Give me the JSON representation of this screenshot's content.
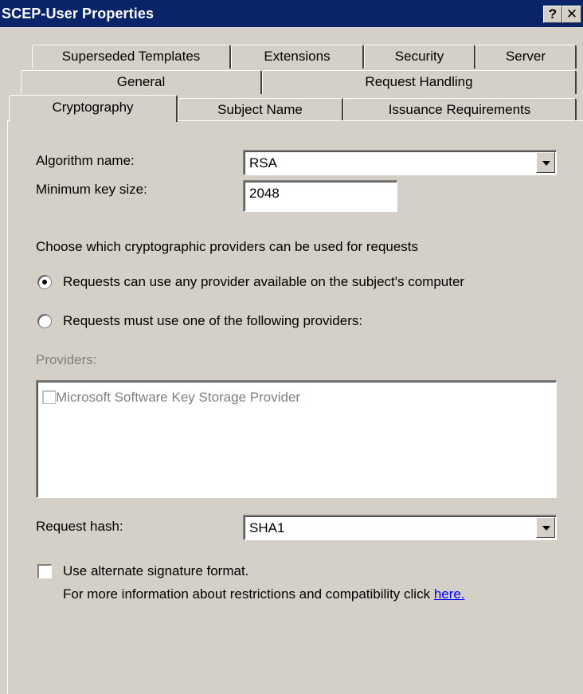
{
  "window": {
    "title": "SCEP-User Properties",
    "help_label": "?",
    "close_label": "✕"
  },
  "tabs": {
    "row1": [
      "Superseded Templates",
      "Extensions",
      "Security",
      "Server"
    ],
    "row2": [
      "General",
      "Request Handling"
    ],
    "row3": [
      "Cryptography",
      "Subject Name",
      "Issuance Requirements"
    ],
    "active": "Cryptography"
  },
  "form": {
    "algorithm_label": "Algorithm name:",
    "algorithm_value": "RSA",
    "min_key_label": "Minimum key size:",
    "min_key_value": "2048",
    "providers_prompt": "Choose which cryptographic providers can be used for requests",
    "radio_any_label": "Requests can use any provider available on the subject's computer",
    "radio_any_selected": true,
    "radio_specific_label": "Requests must use one of the following providers:",
    "radio_specific_selected": false,
    "providers_label": "Providers:",
    "providers": [
      {
        "name": "Microsoft Software Key Storage Provider",
        "checked": false
      }
    ],
    "hash_label": "Request hash:",
    "hash_value": "SHA1",
    "alt_sig_label": "Use alternate signature format.",
    "alt_sig_checked": false,
    "info_text": "For more information about restrictions and compatibility click",
    "info_link": "here."
  },
  "colors": {
    "titlebar": "#0a246a",
    "face": "#d4d0c8",
    "disabled_text": "#808080",
    "link": "#0000ff"
  }
}
